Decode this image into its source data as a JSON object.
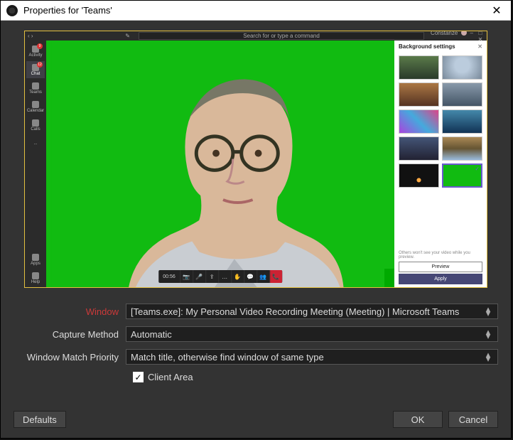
{
  "titlebar": {
    "title": "Properties for 'Teams'"
  },
  "teams": {
    "search_placeholder": "Search for or type a command",
    "user_name": "Constanze",
    "rail": [
      {
        "label": "Activity",
        "badge": "9"
      },
      {
        "label": "Chat",
        "badge": "12"
      },
      {
        "label": "Teams",
        "badge": ""
      },
      {
        "label": "Calendar",
        "badge": ""
      },
      {
        "label": "Calls",
        "badge": ""
      },
      {
        "label": "...",
        "badge": ""
      }
    ],
    "rail_bottom": [
      {
        "label": "Apps"
      },
      {
        "label": "Help"
      }
    ],
    "call_time": "00:56",
    "bg_panel": {
      "title": "Background settings",
      "note": "Others won't see your video while you preview.",
      "preview": "Preview",
      "apply": "Apply"
    }
  },
  "form": {
    "window_label": "Window",
    "window_value": "[Teams.exe]: My Personal Video Recording Meeting (Meeting) | Microsoft Teams",
    "capture_method_label": "Capture Method",
    "capture_method_value": "Automatic",
    "priority_label": "Window Match Priority",
    "priority_value": "Match title, otherwise find window of same type",
    "client_area_label": "Client Area"
  },
  "buttons": {
    "defaults": "Defaults",
    "ok": "OK",
    "cancel": "Cancel"
  }
}
